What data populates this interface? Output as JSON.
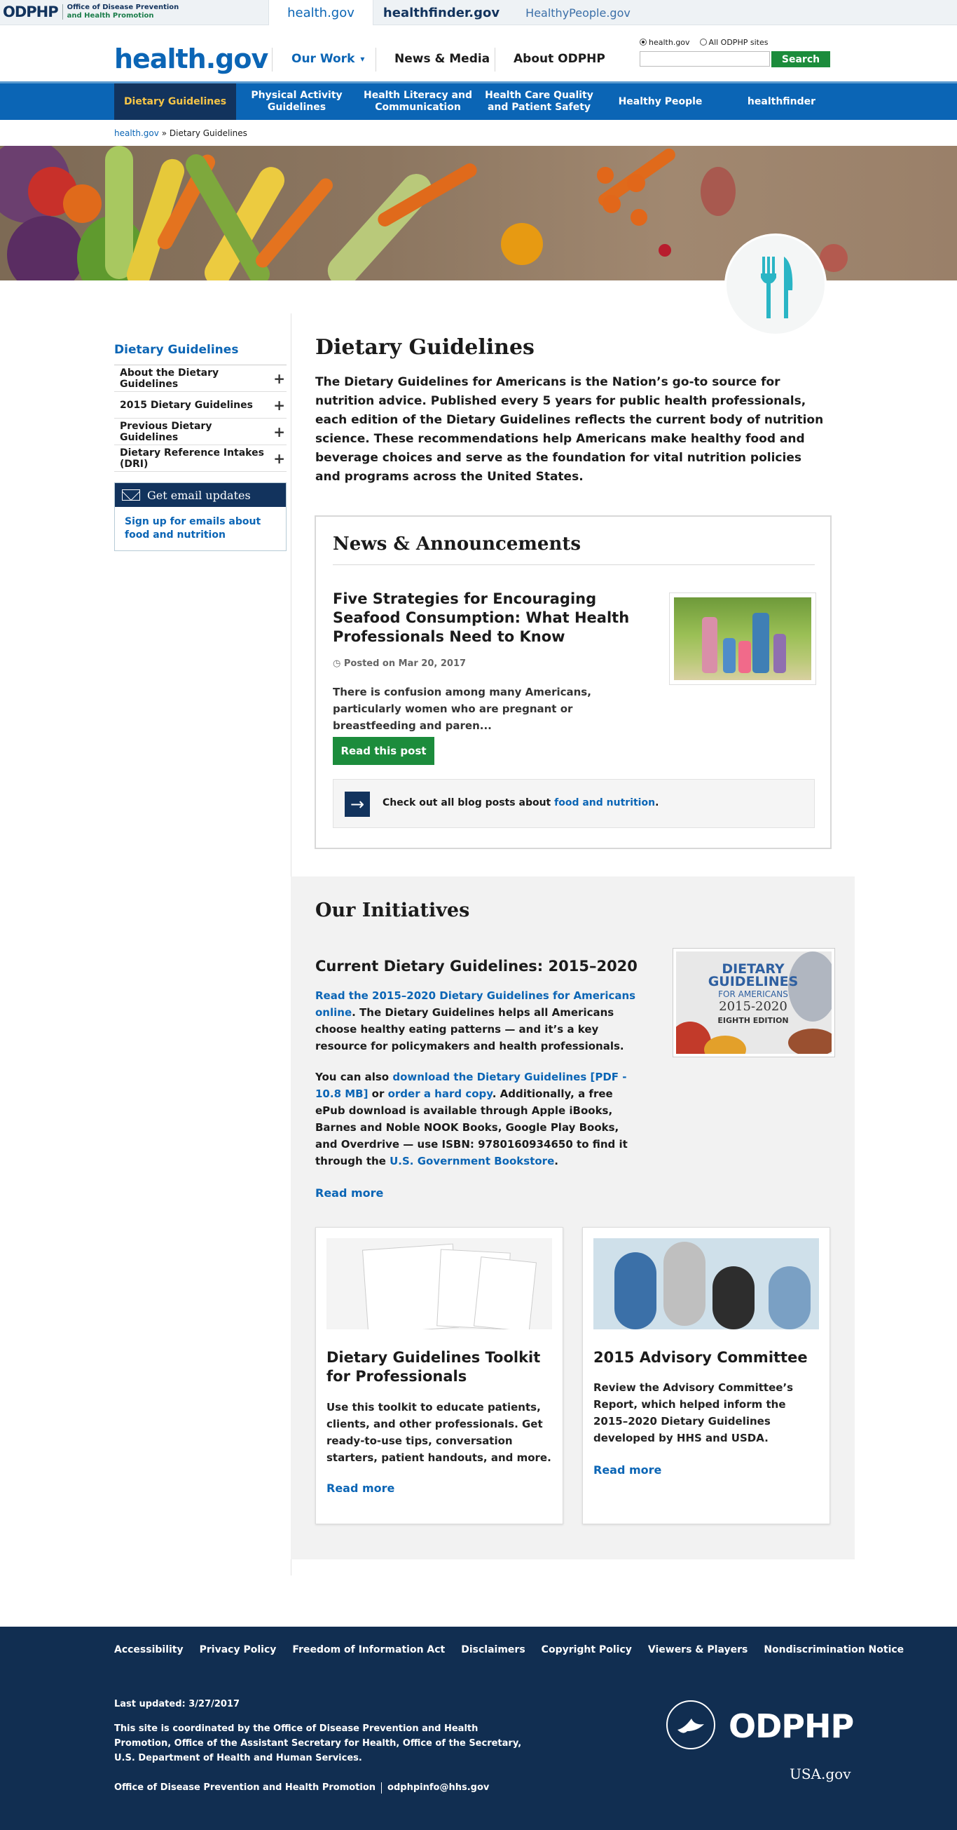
{
  "utility": {
    "logo_mark": "ODPHP",
    "logo_line1": "Office of Disease Prevention",
    "logo_line2": "and Health Promotion",
    "sites": [
      "health.gov",
      "healthfinder.gov",
      "HealthyPeople.gov"
    ]
  },
  "header": {
    "brand": "health.gov",
    "nav": [
      "Our Work",
      "News & Media",
      "About ODPHP"
    ],
    "search_scope": [
      "health.gov",
      "All ODPHP sites"
    ],
    "search_placeholder": "",
    "search_button": "Search"
  },
  "main_nav": [
    "Dietary Guidelines",
    "Physical Activity Guidelines",
    "Health Literacy and Communication",
    "Health Care Quality and Patient Safety",
    "Healthy People",
    "healthfinder"
  ],
  "breadcrumb": {
    "home": "health.gov",
    "sep": "»",
    "current": "Dietary Guidelines"
  },
  "sidebar": {
    "title": "Dietary Guidelines",
    "items": [
      "About the Dietary Guidelines",
      "2015 Dietary Guidelines",
      "Previous Dietary Guidelines",
      "Dietary Reference Intakes (DRI)"
    ],
    "email_title": "Get email updates",
    "email_link": "Sign up for emails about food and nutrition"
  },
  "page": {
    "title": "Dietary Guidelines",
    "intro": "The Dietary Guidelines for Americans is the Nation’s go-to source for nutrition advice. Published every 5 years for public health professionals, each edition of the Dietary Guidelines reflects the current body of nutrition science. These recommendations help Americans make healthy food and beverage choices and serve as the foundation for vital nutrition policies and programs across the United States."
  },
  "news": {
    "heading": "News & Announcements",
    "post_title": "Five Strategies for Encouraging Seafood Consumption: What Health Professionals Need to Know",
    "post_date": "Posted on Mar 20, 2017",
    "post_excerpt": "There is confusion among many Americans, particularly women who are pregnant or breastfeeding and paren...",
    "read_button": "Read this post",
    "callout_text": "Check out all blog posts about ",
    "callout_link": "food and nutrition",
    "callout_end": "."
  },
  "initiatives": {
    "heading": "Our Initiatives",
    "sub": "Current Dietary Guidelines: 2015–2020",
    "p1_link": "Read the 2015–2020 Dietary Guidelines for Americans online",
    "p1_text": ". The Dietary Guidelines helps all Americans choose healthy eating patterns — and it’s a key resource for policymakers and health professionals.",
    "p2_a": "You can also ",
    "p2_link1": "download the Dietary Guidelines [PDF - 10.8 MB]",
    "p2_b": " or ",
    "p2_link2": "order a hard copy",
    "p2_c": ". Additionally, a free ePub download is available through Apple iBooks, Barnes and Noble NOOK Books, Google Play Books, and Overdrive — use ISBN: 9780160934650 to find it through the ",
    "p2_link3": "U.S. Government Bookstore",
    "p2_d": ".",
    "read_more": "Read more",
    "cover": {
      "l1": "DIETARY",
      "l2": "GUIDELINES",
      "l3": "FOR AMERICANS",
      "l4": "2015-2020",
      "l5": "EIGHTH EDITION"
    },
    "cards": [
      {
        "title": "Dietary Guidelines Toolkit for Professionals",
        "body": "Use this toolkit to educate patients, clients, and other professionals. Get ready-to-use tips, conversation starters, patient handouts, and more.",
        "link": "Read more"
      },
      {
        "title": "2015 Advisory Committee",
        "body": "Review the Advisory Committee’s Report, which helped inform the 2015–2020 Dietary Guidelines developed by HHS and USDA.",
        "link": "Read more"
      }
    ]
  },
  "footer": {
    "links": [
      "Accessibility",
      "Privacy Policy",
      "Freedom of Information Act",
      "Disclaimers",
      "Copyright Policy",
      "Viewers & Players",
      "Nondiscrimination Notice"
    ],
    "updated": "Last updated: 3/27/2017",
    "coordinated": "This site is coordinated by the Office of Disease Prevention and Health Promotion, Office of the Assistant Secretary for Health, Office of the Secretary, U.S. Department of Health and Human Services.",
    "office": "Office of Disease Prevention and Health Promotion",
    "email": "odphpinfo@hhs.gov",
    "logo": "ODPHP",
    "usagov": "USA.gov"
  }
}
